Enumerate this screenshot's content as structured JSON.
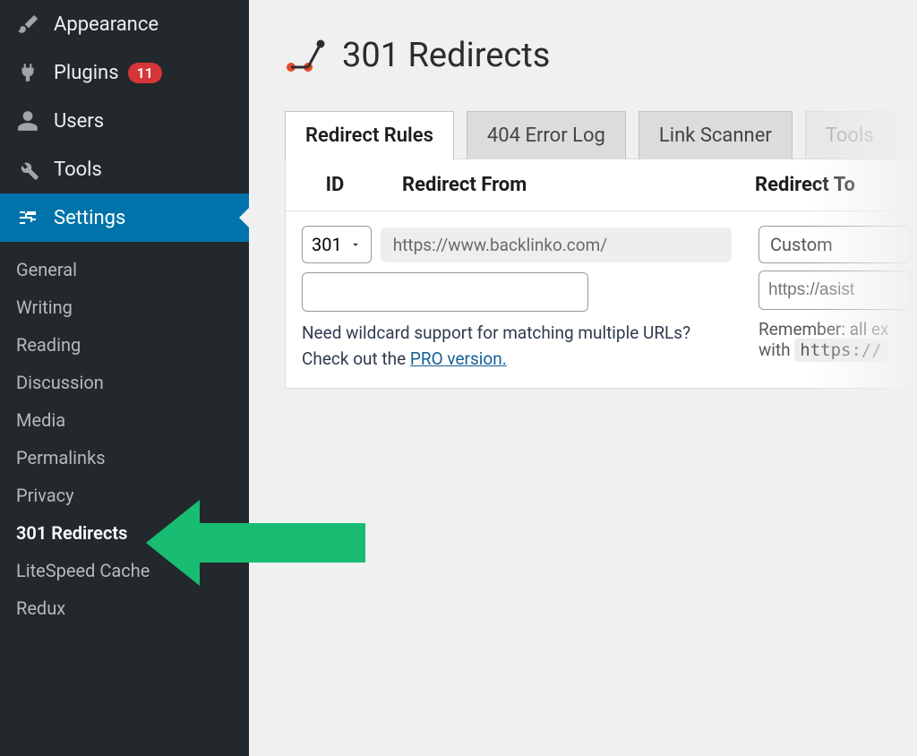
{
  "sidebar": {
    "main_items": [
      {
        "label": "Appearance",
        "icon": "appearance"
      },
      {
        "label": "Plugins",
        "icon": "plugins",
        "badge": "11"
      },
      {
        "label": "Users",
        "icon": "users"
      },
      {
        "label": "Tools",
        "icon": "tools"
      },
      {
        "label": "Settings",
        "icon": "settings",
        "selected": true
      }
    ],
    "sub_items": [
      {
        "label": "General"
      },
      {
        "label": "Writing"
      },
      {
        "label": "Reading"
      },
      {
        "label": "Discussion"
      },
      {
        "label": "Media"
      },
      {
        "label": "Permalinks"
      },
      {
        "label": "Privacy"
      },
      {
        "label": "301 Redirects",
        "active": true
      },
      {
        "label": "LiteSpeed Cache"
      },
      {
        "label": "Redux"
      }
    ]
  },
  "page": {
    "title": "301 Redirects"
  },
  "tabs": [
    {
      "label": "Redirect Rules",
      "active": true
    },
    {
      "label": "404 Error Log"
    },
    {
      "label": "Link Scanner"
    },
    {
      "label": "Tools",
      "fade": true
    }
  ],
  "table": {
    "headers": {
      "id": "ID",
      "from": "Redirect From",
      "to": "Redirect To"
    },
    "row": {
      "type_value": "301",
      "base_url": "https://www.backlinko.com/",
      "from_value": "",
      "to_type": "Custom",
      "to_placeholder": "https://asist",
      "hint_pre": "Need wildcard support for matching multiple URLs? Check out the ",
      "hint_link": "PRO version.",
      "remember_pre": "Remember: all ex",
      "remember_with": "with ",
      "remember_code": "https://"
    }
  }
}
